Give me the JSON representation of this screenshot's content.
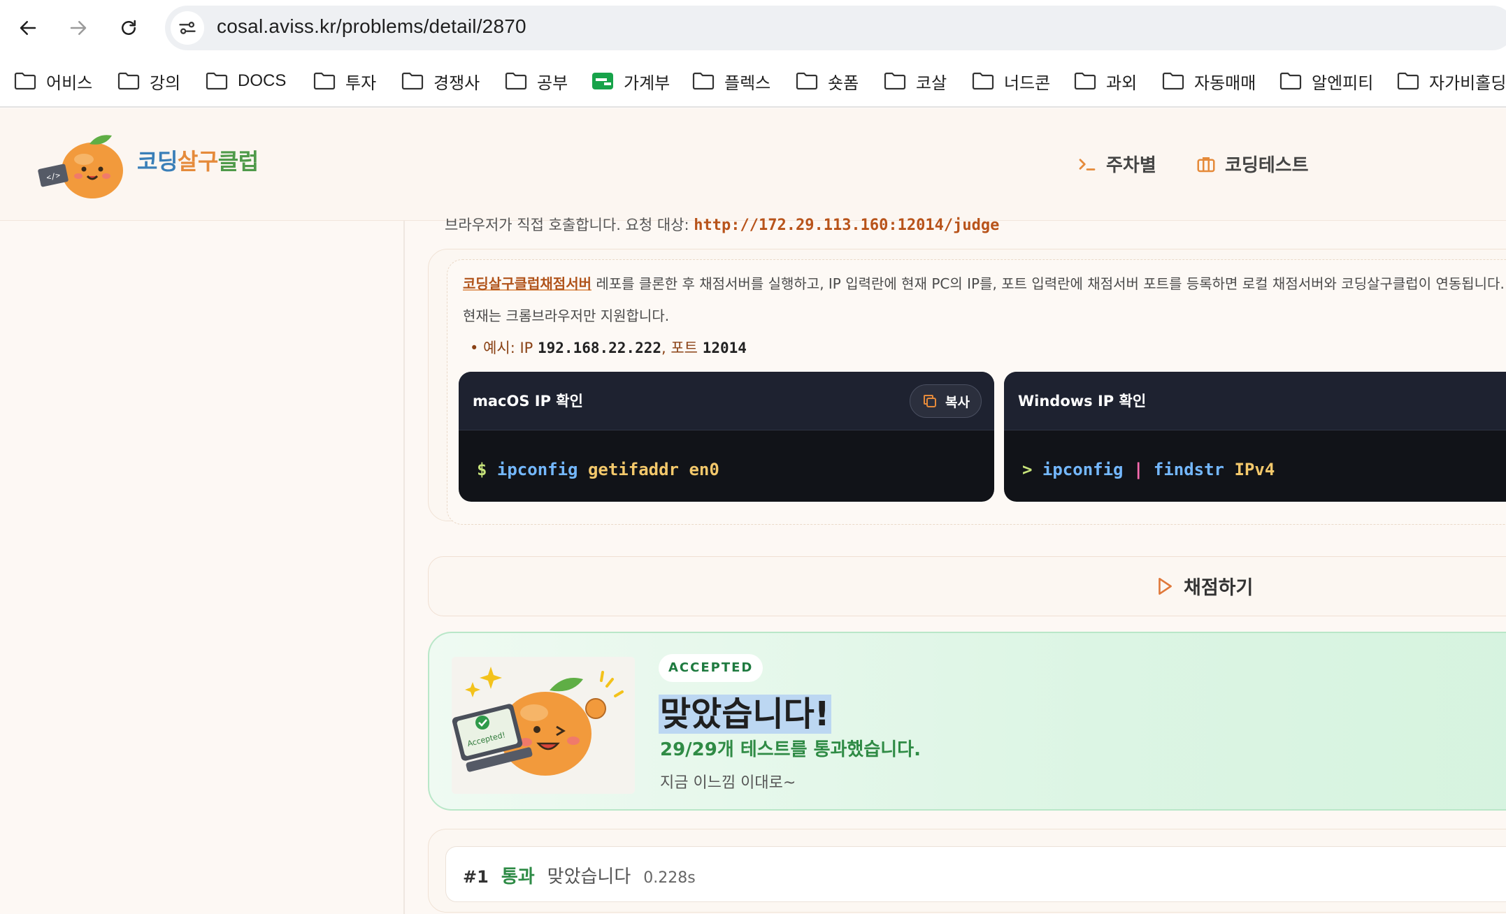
{
  "browser": {
    "url": "cosal.aviss.kr/problems/detail/2870",
    "bookmarks": [
      "어비스",
      "강의",
      "DOCS",
      "투자",
      "경쟁사",
      "공부",
      "가계부",
      "플렉스",
      "숏폼",
      "코살",
      "너드콘",
      "과외",
      "자동매매",
      "알엔피티",
      "자가비홀딩"
    ]
  },
  "header": {
    "brand_parts": [
      "코딩",
      "살구",
      "클럽"
    ],
    "nav": [
      "주차별",
      "코딩테스트"
    ]
  },
  "judge": {
    "direct_prefix": "브라우저가 직접 호출합니다. 요청 대상:",
    "direct_url": "http://172.29.113.160:12014/judge",
    "server_link": "코딩살구클럽채점서버",
    "server_text": "레포를 클론한 후 채점서버를 실행하고, IP 입력란에 현재 PC의 IP를, 포트 입력란에 채점서버 포트를 등록하면 로컬 채점서버와 코딩살구클럽이 연동됩니다.",
    "browser_note": "현재는 크롬브라우저만 지원합니다.",
    "example_prefix": "예시: IP",
    "example_ip": "192.168.22.222",
    "example_mid": ", 포트",
    "example_port": "12014"
  },
  "terminals": [
    {
      "title": "macOS IP 확인",
      "copy_label": "복사",
      "prompt": "$",
      "cmd": "ipconfig",
      "args": "getifaddr en0",
      "pipe": "",
      "cmd2": "",
      "args2": ""
    },
    {
      "title": "Windows IP 확인",
      "copy_label": "",
      "prompt": ">",
      "cmd": "ipconfig",
      "args": "",
      "pipe": "|",
      "cmd2": "findstr",
      "args2": "IPv4"
    }
  ],
  "grade_button": "채점하기",
  "result": {
    "badge": "ACCEPTED",
    "title": "맞았습니다!",
    "subtitle": "29/29개 테스트를 통과했습니다.",
    "message": "지금 이느낌 이대로~",
    "mascot_label": "Accepted!"
  },
  "cases": [
    {
      "no": "#1",
      "status": "통과",
      "message": "맞았습니다",
      "time": "0.228s"
    }
  ],
  "colors": {
    "accent": "#e58a3a",
    "success": "#2f8b45",
    "link": "#b0531a"
  }
}
